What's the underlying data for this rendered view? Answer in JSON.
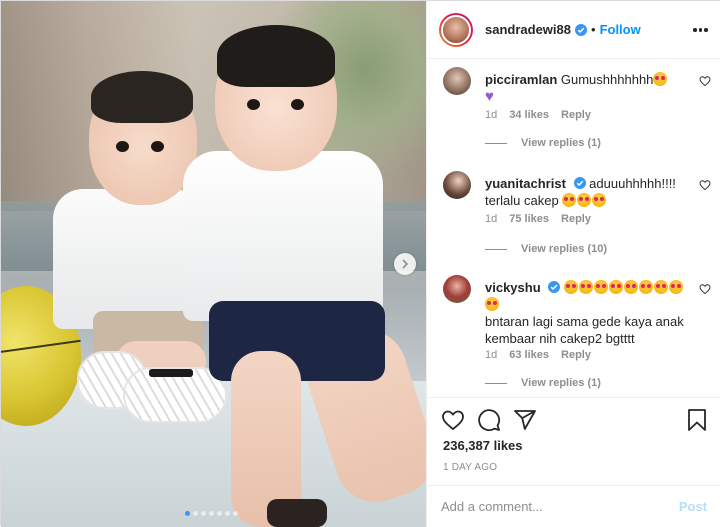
{
  "post": {
    "username": "sandradewi88",
    "separator": "•",
    "follow_label": "Follow",
    "likes_text": "236,387 likes",
    "time_ago": "1 DAY AGO",
    "add_comment_placeholder": "Add a comment...",
    "post_label": "Post",
    "carousel": {
      "slide_count": 7,
      "active_index": 0
    }
  },
  "comments": [
    {
      "username": "picciramlan",
      "text": "Gumushhhhhhh",
      "emojis_after": [
        "heart-eyes-emoji",
        "purple-heart-emoji"
      ],
      "age": "1d",
      "likes": "34 likes",
      "reply_label": "Reply",
      "view_replies": "View replies (1)"
    },
    {
      "username": "yuanitachrist",
      "verified": true,
      "text": "aduuuhhhhh!!!!",
      "text_line2": "terlalu cakep",
      "emojis_after": [
        "heart-eyes-emoji",
        "heart-eyes-emoji",
        "heart-eyes-emoji"
      ],
      "age": "1d",
      "likes": "75 likes",
      "reply_label": "Reply",
      "view_replies": "View replies (10)"
    },
    {
      "username": "vickyshu",
      "verified": true,
      "text": "bntaran lagi sama gede kaya anak kembaar nih cakep2 bgtttt",
      "emoji_count": 9,
      "age": "1d",
      "likes": "63 likes",
      "reply_label": "Reply",
      "view_replies": "View replies (1)"
    }
  ],
  "colors": {
    "link_blue": "#0095f6",
    "verified_blue": "#3897f0",
    "muted": "#8e8e8e",
    "post_disabled": "#b2dffc"
  },
  "icons": [
    "heart-icon",
    "comment-icon",
    "share-icon",
    "bookmark-icon",
    "more-options-icon",
    "chevron-right-icon",
    "verified-badge-icon"
  ]
}
